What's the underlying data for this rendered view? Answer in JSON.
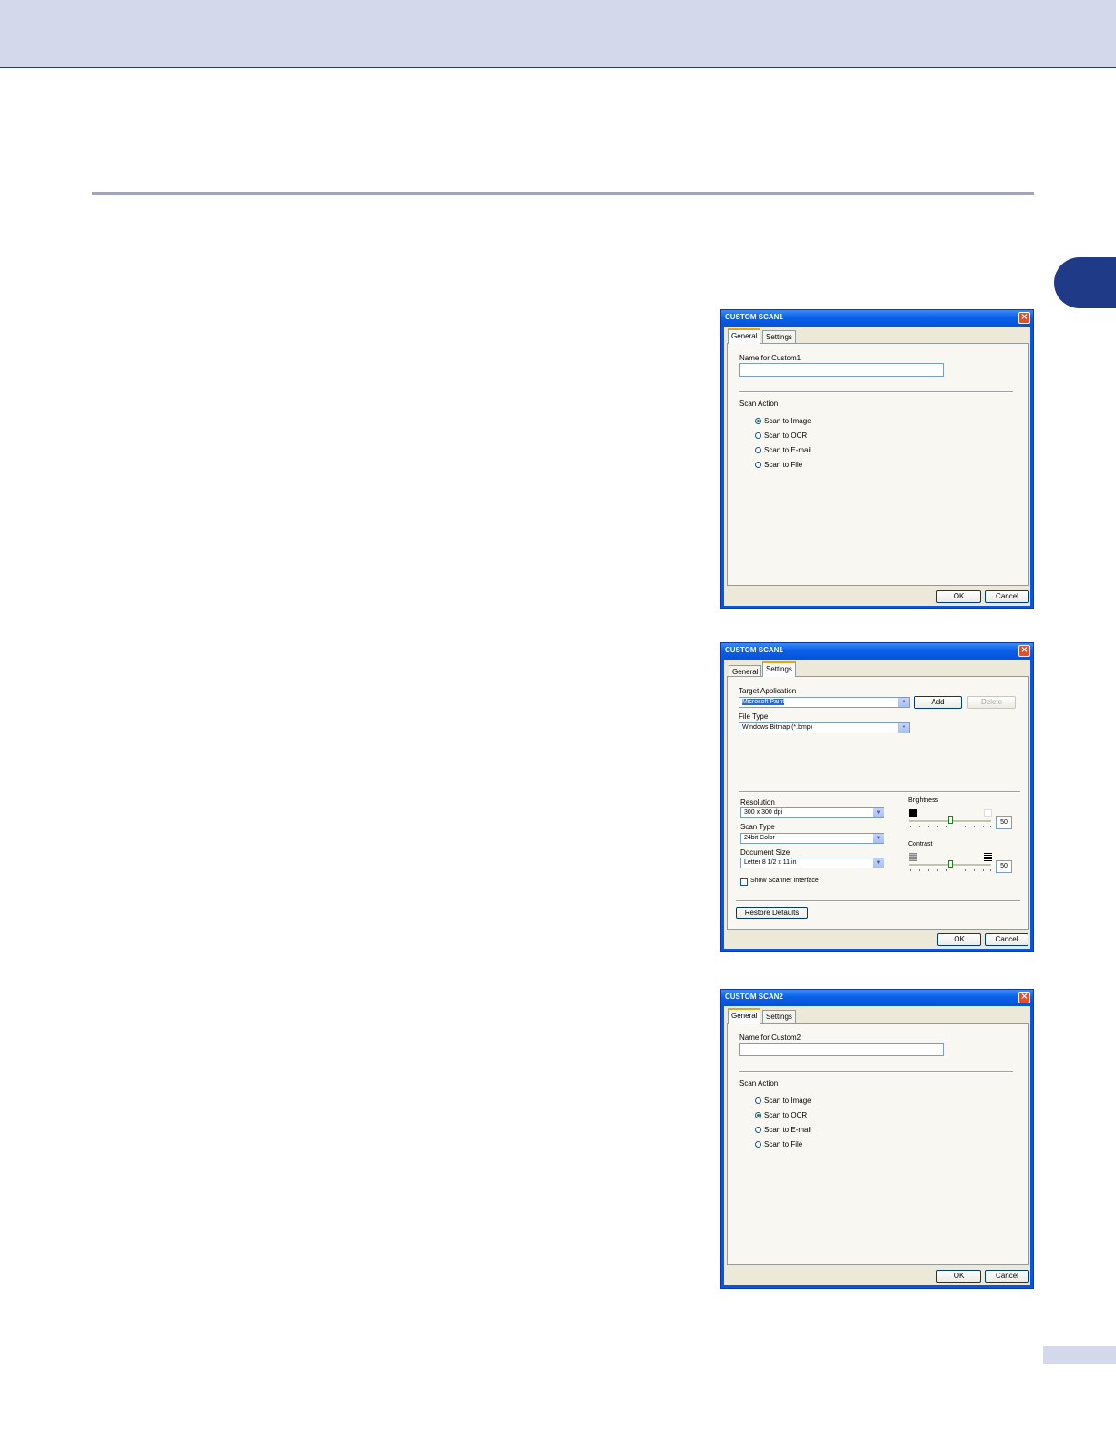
{
  "dialog1": {
    "title": "CUSTOM SCAN1",
    "tabs": [
      "General",
      "Settings"
    ],
    "name_label": "Name for Custom1",
    "name_value": "",
    "scan_action_label": "Scan Action",
    "options": [
      "Scan to Image",
      "Scan to OCR",
      "Scan to E-mail",
      "Scan to File"
    ],
    "selected_option": "Scan to Image",
    "ok_label": "OK",
    "cancel_label": "Cancel"
  },
  "dialog2": {
    "title": "CUSTOM SCAN1",
    "tabs": [
      "General",
      "Settings"
    ],
    "target_app_label": "Target Application",
    "target_app_value": "Microsoft Paint",
    "add_label": "Add",
    "delete_label": "Delete",
    "file_type_label": "File Type",
    "file_type_value": "Windows Bitmap (*.bmp)",
    "resolution_label": "Resolution",
    "resolution_value": "300 x 300 dpi",
    "scan_type_label": "Scan Type",
    "scan_type_value": "24bit Color",
    "document_size_label": "Document Size",
    "document_size_value": "Letter 8 1/2 x 11 in",
    "show_scanner_label": "Show Scanner Interface",
    "show_scanner_checked": false,
    "brightness_label": "Brightness",
    "brightness_value": "50",
    "contrast_label": "Contrast",
    "contrast_value": "50",
    "restore_label": "Restore Defaults",
    "ok_label": "OK",
    "cancel_label": "Cancel"
  },
  "dialog3": {
    "title": "CUSTOM SCAN2",
    "tabs": [
      "General",
      "Settings"
    ],
    "name_label": "Name for Custom2",
    "name_value": "",
    "scan_action_label": "Scan Action",
    "options": [
      "Scan to Image",
      "Scan to OCR",
      "Scan to E-mail",
      "Scan to File"
    ],
    "selected_option": "Scan to OCR",
    "ok_label": "OK",
    "cancel_label": "Cancel"
  },
  "colors": {
    "header_band": "#d3d8ea",
    "accent_blue": "#1f3a87",
    "xp_title": "#0a5fe8",
    "dialog_face": "#ece9d8"
  }
}
